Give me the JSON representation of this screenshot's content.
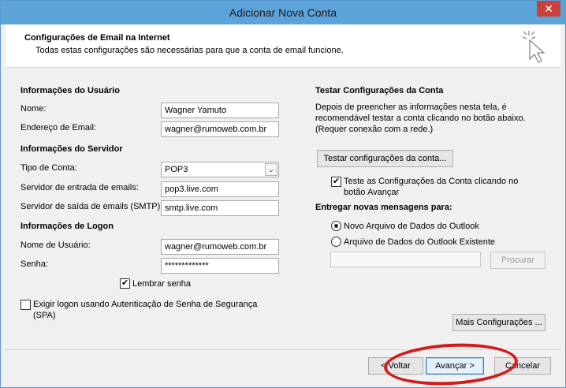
{
  "window": {
    "title": "Adicionar Nova Conta",
    "close_label": "✕"
  },
  "header": {
    "title": "Configurações de Email na Internet",
    "subtitle": "Todas estas configurações são necessárias para que a conta de email funcione.",
    "icon": "cursor-click-icon"
  },
  "user_info": {
    "heading": "Informações do Usuário",
    "name_label": "Nome:",
    "name_value": "Wagner Yamuto",
    "email_label": "Endereço de Email:",
    "email_value": "wagner@rumoweb.com.br"
  },
  "server_info": {
    "heading": "Informações do Servidor",
    "account_type_label": "Tipo de Conta:",
    "account_type_value": "POP3",
    "incoming_label": "Servidor de entrada de emails:",
    "incoming_value": "pop3.live.com",
    "outgoing_label": "Servidor de saída de emails (SMTP):",
    "outgoing_value": "smtp.live.com"
  },
  "logon_info": {
    "heading": "Informações de Logon",
    "username_label": "Nome de Usuário:",
    "username_value": "wagner@rumoweb.com.br",
    "password_label": "Senha:",
    "password_value": "*************",
    "remember_label": "Lembrar senha",
    "remember_checked": "✔",
    "spa_label_line1": "Exigir logon usando Autenticação de Senha de Segurança",
    "spa_label_line2": "(SPA)"
  },
  "test_settings": {
    "heading": "Testar Configurações da Conta",
    "description_line1": "Depois de preencher as informações nesta tela, é",
    "description_line2": "recomendável testar a conta clicando no botão abaixo.",
    "description_line3": "(Requer conexão com a rede.)",
    "test_button": "Testar configurações da conta...",
    "auto_test_line1": "Teste as Configurações da Conta clicando no",
    "auto_test_line2": "botão Avançar",
    "auto_test_checked": "✔"
  },
  "delivery": {
    "heading": "Entregar novas mensagens para:",
    "option_new": "Novo Arquivo de Dados do Outlook",
    "option_existing": "Arquivo de Dados do Outlook Existente",
    "path_value": "",
    "browse_button": "Procurar"
  },
  "more_settings_button": "Mais Configurações ...",
  "footer": {
    "back_button": "< Voltar",
    "next_button": "Avançar >",
    "cancel_button": "Cancelar"
  },
  "colors": {
    "titlebar": "#5ca3da",
    "close": "#c9423a",
    "annotation": "#d41b1b"
  }
}
